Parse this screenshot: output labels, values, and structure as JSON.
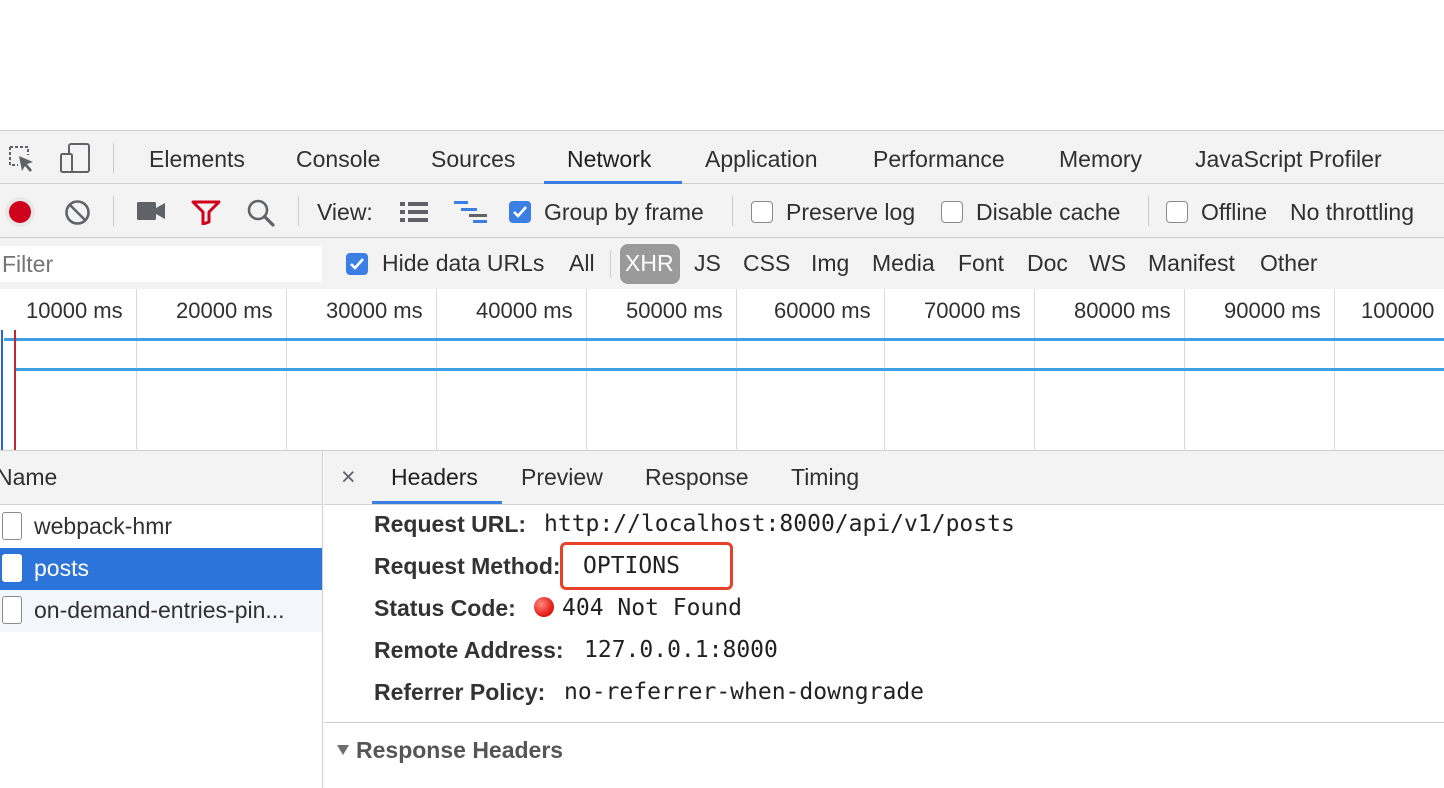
{
  "tabs": {
    "items": [
      {
        "label": "Elements"
      },
      {
        "label": "Console"
      },
      {
        "label": "Sources"
      },
      {
        "label": "Network"
      },
      {
        "label": "Application"
      },
      {
        "label": "Performance"
      },
      {
        "label": "Memory"
      },
      {
        "label": "JavaScript Profiler"
      }
    ],
    "active": "Network",
    "accent": "#3b7fe4"
  },
  "toolbar": {
    "icons": [
      "inspect-element-icon",
      "device-toggle-icon",
      "record-icon",
      "clear-icon",
      "capture-screenshots-icon",
      "filter-icon",
      "search-icon",
      "large-rows-icon",
      "overview-icon"
    ],
    "view_label": "View:",
    "group_by_frame": {
      "label": "Group by frame",
      "checked": true
    },
    "preserve_log": {
      "label": "Preserve log",
      "checked": false
    },
    "disable_cache": {
      "label": "Disable cache",
      "checked": false
    },
    "offline": {
      "label": "Offline",
      "checked": false
    },
    "throttling": "No throttling",
    "record_color": "#d0021b",
    "filter_color": "#d0021b"
  },
  "filterbar": {
    "placeholder": "Filter",
    "hide_data_urls": {
      "label": "Hide data URLs",
      "checked": true
    },
    "types": [
      "All",
      "XHR",
      "JS",
      "CSS",
      "Img",
      "Media",
      "Font",
      "Doc",
      "WS",
      "Manifest",
      "Other"
    ],
    "active_type": "XHR"
  },
  "timeline": {
    "ticks": [
      "10000 ms",
      "20000 ms",
      "30000 ms",
      "40000 ms",
      "50000 ms",
      "60000 ms",
      "70000 ms",
      "80000 ms",
      "90000 ms",
      "100000"
    ]
  },
  "requests": {
    "header": "Name",
    "items": [
      {
        "name": "webpack-hmr",
        "selected": false
      },
      {
        "name": "posts",
        "selected": true
      },
      {
        "name": "on-demand-entries-pin...",
        "selected": false
      }
    ],
    "selected_color": "#2d74da"
  },
  "details": {
    "close_glyph": "×",
    "tabs": [
      "Headers",
      "Preview",
      "Response",
      "Timing"
    ],
    "active_tab": "Headers",
    "general": [
      {
        "key": "Request URL:",
        "value": "http://localhost:8000/api/v1/posts"
      },
      {
        "key": "Request Method:",
        "value": "OPTIONS"
      },
      {
        "key": "Status Code:",
        "value": "404 Not Found",
        "status_color": "#e8201a"
      },
      {
        "key": "Remote Address:",
        "value": "127.0.0.1:8000"
      },
      {
        "key": "Referrer Policy:",
        "value": "no-referrer-when-downgrade"
      }
    ],
    "highlight_color": "#e8412a",
    "section": "Response Headers"
  }
}
